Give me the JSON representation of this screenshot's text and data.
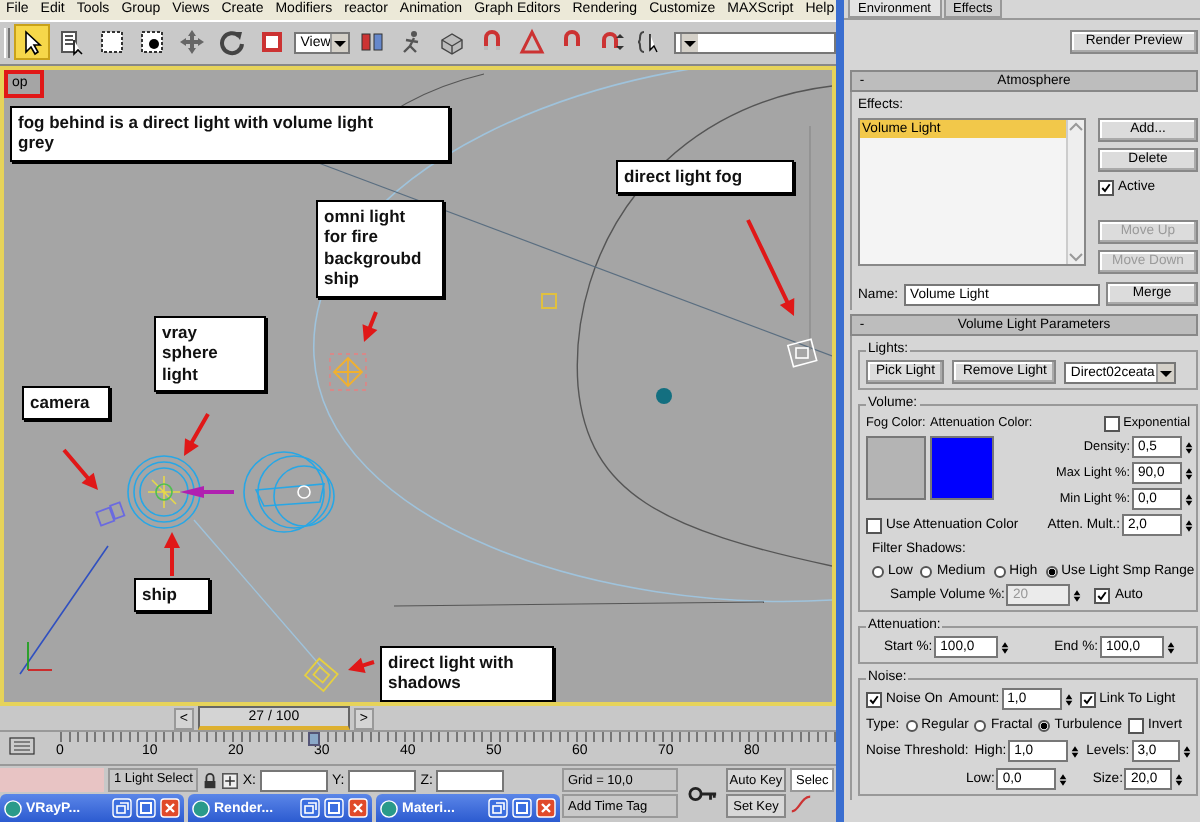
{
  "menu_bar": [
    {
      "label": "File"
    },
    {
      "label": "Edit"
    },
    {
      "label": "Tools"
    },
    {
      "label": "Group"
    },
    {
      "label": "Views"
    },
    {
      "label": "Create"
    },
    {
      "label": "Modifiers"
    },
    {
      "label": "reactor"
    },
    {
      "label": "Animation"
    },
    {
      "label": "Graph Editors"
    },
    {
      "label": "Rendering"
    },
    {
      "label": "Customize"
    },
    {
      "label": "MAXScript"
    },
    {
      "label": "Help"
    }
  ],
  "toolbar": {
    "view_dropdown": "View"
  },
  "viewport": {
    "label": "op",
    "annotations": [
      {
        "text": "fog behind is a direct light with volume light\ngrey"
      },
      {
        "text": "direct light fog"
      },
      {
        "text": "omni light\nfor fire\nbackgroubd\nship"
      },
      {
        "text": "vray\nsphere\nlight"
      },
      {
        "text": "camera"
      },
      {
        "text": "ship"
      },
      {
        "text": "direct light with\nshadows"
      }
    ]
  },
  "time_slider": {
    "prev": "<",
    "label": "27 / 100",
    "next": ">",
    "level": 0.27
  },
  "track_bar": {
    "ticks": [
      "0",
      "10",
      "20",
      "30",
      "40",
      "50",
      "60",
      "70",
      "80"
    ]
  },
  "status_bar": {
    "selection": "1 Light Select",
    "coords": [
      {
        "label": "X:"
      },
      {
        "label": "Y:"
      },
      {
        "label": "Z:"
      }
    ],
    "grid": "Grid = 10,0",
    "time_tag": "Add Time Tag",
    "auto_key": "Auto Key",
    "key_filter": "Selec",
    "set_key": "Set Key"
  },
  "taskbar": [
    {
      "title": "VRayP..."
    },
    {
      "title": "Render..."
    },
    {
      "title": "Materi..."
    }
  ],
  "panel": {
    "tabs": [
      {
        "label": "Environment",
        "selected": true
      },
      {
        "label": "Effects",
        "selected": false
      }
    ],
    "render_preview": "Render Preview",
    "atmosphere": {
      "toggle": "-",
      "title": "Atmosphere",
      "effects_label": "Effects:",
      "effects": [
        {
          "label": "Volume Light",
          "selected": true
        }
      ],
      "buttons": [
        {
          "label": "Add...",
          "disabled": false
        },
        {
          "label": "Delete",
          "disabled": false
        }
      ],
      "active": {
        "label": "Active",
        "checked": true
      },
      "move_buttons": [
        {
          "label": "Move Up",
          "disabled": true
        },
        {
          "label": "Move Down",
          "disabled": true
        }
      ],
      "name_label": "Name:",
      "name_value": "Volume Light",
      "merge": "Merge"
    },
    "volume_light": {
      "toggle": "-",
      "title": "Volume Light Parameters",
      "lights": {
        "legend": "Lights:",
        "pick": "Pick Light",
        "remove": "Remove Light",
        "light": "Direct02ceata"
      },
      "volume": {
        "legend": "Volume:",
        "swatches": [
          {
            "label": "Fog Color:",
            "color": "#b4b4b4"
          },
          {
            "label": "Attenuation Color:",
            "color": "#0000ff"
          }
        ],
        "exponential": {
          "label": "Exponential",
          "checked": false
        },
        "spinners": [
          {
            "label": "Density:",
            "value": "0,5"
          },
          {
            "label": "Max Light %:",
            "value": "90,0"
          },
          {
            "label": "Min Light %:",
            "value": "0,0"
          }
        ],
        "use_atten": {
          "label": "Use Attenuation Color",
          "checked": false
        },
        "atten_mult": {
          "label": "Atten. Mult.:",
          "value": "2,0"
        },
        "filter_label": "Filter Shadows:",
        "filter": [
          {
            "label": "Low",
            "selected": false
          },
          {
            "label": "Medium",
            "selected": false
          },
          {
            "label": "High",
            "selected": false
          },
          {
            "label": "Use Light Smp Range",
            "selected": true
          }
        ],
        "sample": {
          "label": "Sample Volume %:",
          "value": "20",
          "disabled": true
        },
        "auto": {
          "label": "Auto",
          "checked": true
        }
      },
      "attenuation": {
        "legend": "Attenuation:",
        "start": {
          "label": "Start %:",
          "value": "100,0"
        },
        "end": {
          "label": "End %:",
          "value": "100,0"
        }
      },
      "noise": {
        "legend": "Noise:",
        "noise_on": {
          "label": "Noise On",
          "checked": true
        },
        "amount": {
          "label": "Amount:",
          "value": "1,0"
        },
        "link": {
          "label": "Link To Light",
          "checked": true
        },
        "type_label": "Type:",
        "types": [
          {
            "label": "Regular",
            "selected": false
          },
          {
            "label": "Fractal",
            "selected": false
          },
          {
            "label": "Turbulence",
            "selected": true
          }
        ],
        "invert": {
          "label": "Invert",
          "checked": false
        },
        "threshold_label": "Noise Threshold:",
        "high": {
          "label": "High:",
          "value": "1,0"
        },
        "levels": {
          "label": "Levels:",
          "value": "3,0"
        },
        "low": {
          "label": "Low:",
          "value": "0,0"
        },
        "size": {
          "label": "Size:",
          "value": "20,0"
        }
      }
    }
  }
}
